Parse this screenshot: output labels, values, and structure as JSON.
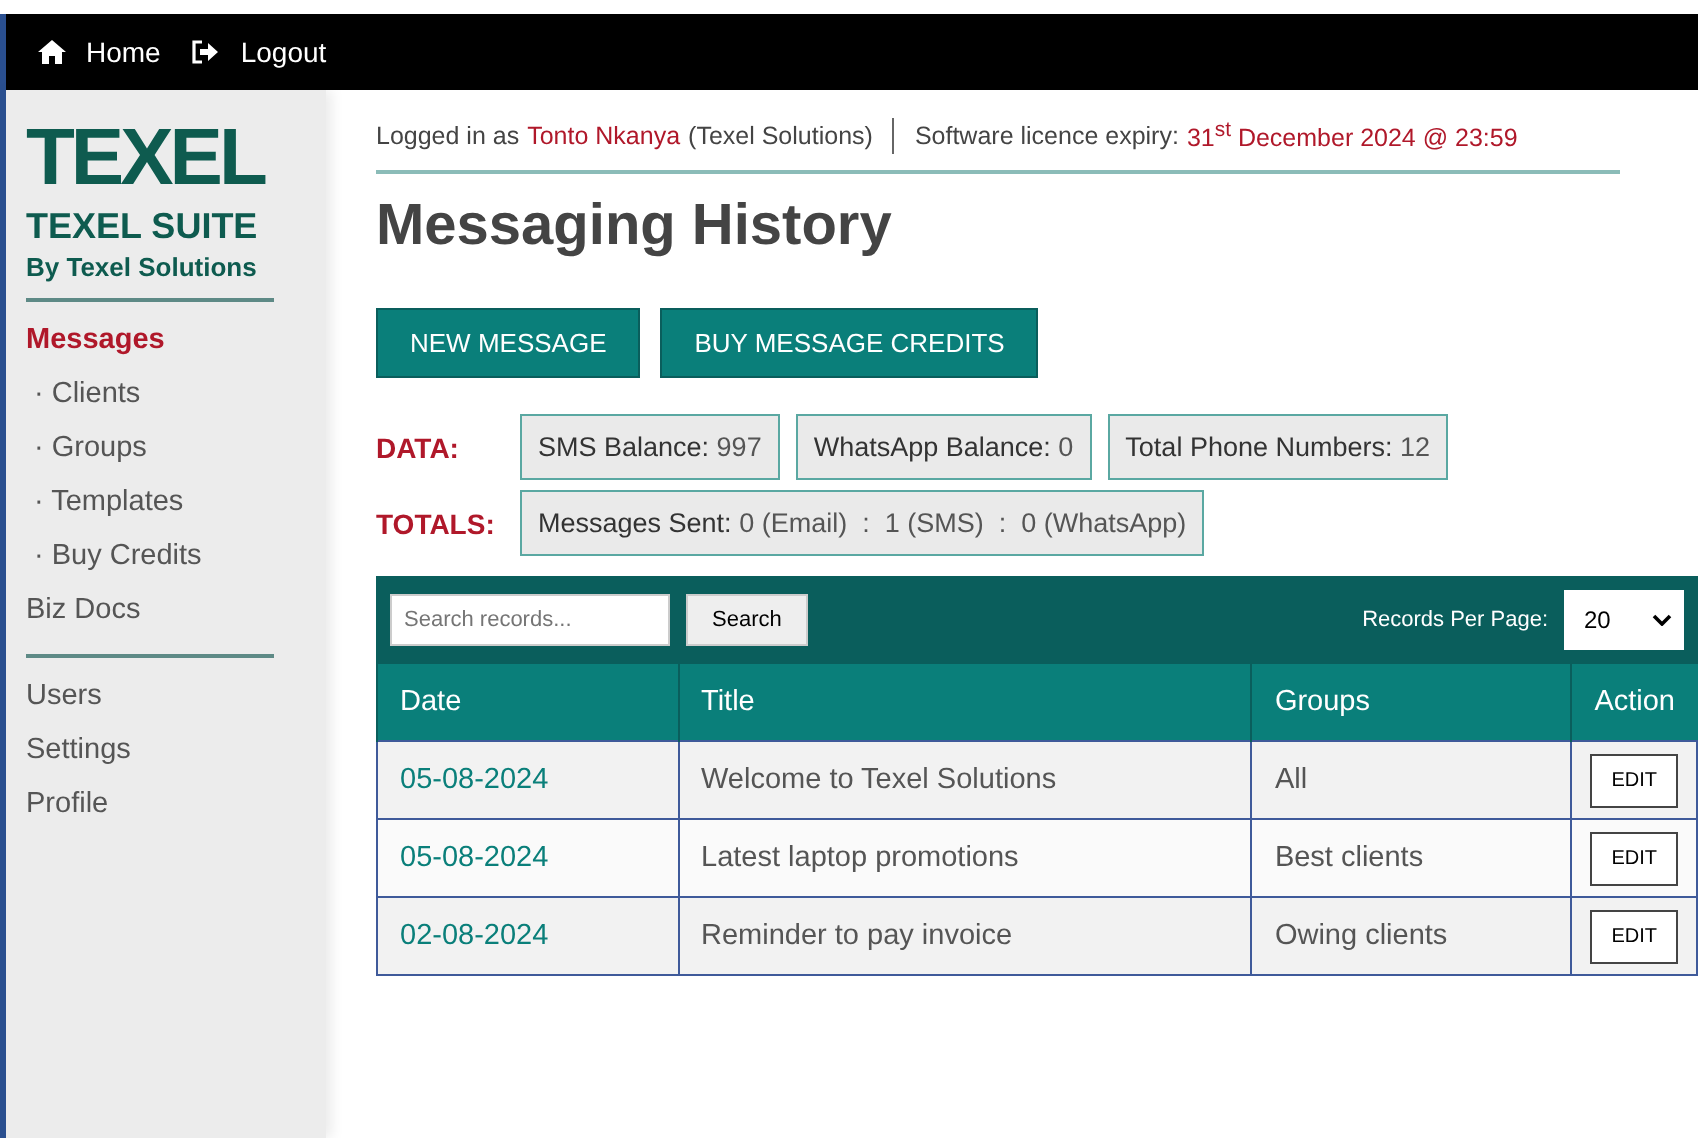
{
  "topbar": {
    "links": [
      {
        "label": "Home",
        "kind": "home"
      },
      {
        "label": "Logout",
        "kind": "logout"
      }
    ]
  },
  "sidebar": {
    "logo": "TEXEL",
    "suite": "TEXEL SUITE",
    "byline": "By Texel Solutions",
    "items": [
      {
        "label": "Messages",
        "kind": "main",
        "selected": true
      },
      {
        "label": "· Clients",
        "kind": "sub",
        "selected": false
      },
      {
        "label": "· Groups",
        "kind": "sub",
        "selected": false
      },
      {
        "label": "· Templates",
        "kind": "sub",
        "selected": false
      },
      {
        "label": "· Buy Credits",
        "kind": "sub",
        "selected": false
      },
      {
        "label": "Biz Docs",
        "kind": "main",
        "selected": false
      }
    ],
    "account_items": [
      {
        "label": "Users",
        "selected": false
      },
      {
        "label": "Settings",
        "selected": false
      },
      {
        "label": "Profile",
        "selected": false
      }
    ]
  },
  "session": {
    "logged_in_label": "Logged in as",
    "user": "Tonto Nkanya",
    "org": "(Texel Solutions)",
    "licence_label": "Software licence expiry:",
    "licence_expiry": "31$^{st}$ December 2024 @ 23:59"
  },
  "page_title": "Messaging History",
  "buttons": [
    "NEW MESSAGE",
    "BUY MESSAGE CREDITS"
  ],
  "data": {
    "label": "DATA:",
    "stats": [
      {
        "label": "SMS Balance:",
        "value": "997"
      },
      {
        "label": "WhatsApp Balance:",
        "value": "0"
      },
      {
        "label": "Total Phone Numbers:",
        "value": "12"
      }
    ]
  },
  "totals": {
    "label": "TOTALS:",
    "stats": [
      {
        "label": "Messages Sent:",
        "value": "0 (Email)  :  1 (SMS)  :  0 (WhatsApp)"
      }
    ]
  },
  "table": {
    "search": {
      "placeholder": "Search records...",
      "button": "Search"
    },
    "per_page_label": "Records Per Page:",
    "per_page": "20",
    "columns": [
      "Date",
      "Title",
      "Groups",
      "Action"
    ],
    "rows": [
      {
        "date": "05-08-2024",
        "title": "Welcome to Texel Solutions",
        "groups": "All",
        "action": "EDIT"
      },
      {
        "date": "05-08-2024",
        "title": "Latest laptop promotions",
        "groups": "Best clients",
        "action": "EDIT"
      },
      {
        "date": "02-08-2024",
        "title": "Reminder to pay invoice",
        "groups": "Owing clients",
        "action": "EDIT"
      }
    ]
  }
}
